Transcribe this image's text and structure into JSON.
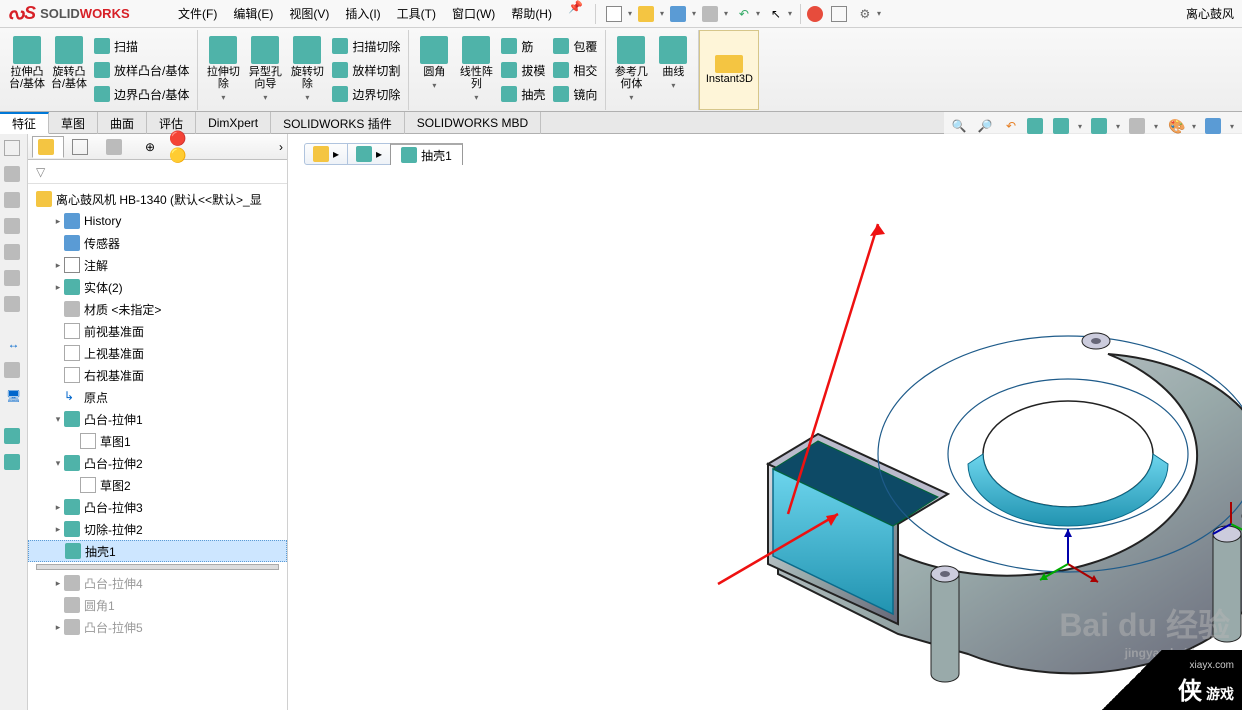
{
  "app": {
    "brand_solid": "SOLID",
    "brand_works": "WORKS",
    "doc_title": "离心鼓风"
  },
  "menu": {
    "file": "文件(F)",
    "edit": "编辑(E)",
    "view": "视图(V)",
    "insert": "插入(I)",
    "tools": "工具(T)",
    "window": "窗口(W)",
    "help": "帮助(H)"
  },
  "ribbon": {
    "extrude_boss": "拉伸凸\n台/基体",
    "revolve_boss": "旋转凸\n台/基体",
    "sweep": "扫描",
    "loft": "放样凸台/基体",
    "boundary": "边界凸台/基体",
    "extrude_cut": "拉伸切\n除",
    "hole_wizard": "异型孔\n向导",
    "revolve_cut": "旋转切\n除",
    "sweep_cut": "扫描切除",
    "loft_cut": "放样切割",
    "boundary_cut": "边界切除",
    "fillet": "圆角",
    "linear_pattern": "线性阵\n列",
    "rib": "筋",
    "draft": "拔模",
    "shell": "抽壳",
    "wrap": "包覆",
    "intersect": "相交",
    "mirror": "镜向",
    "ref_geom": "参考几\n何体",
    "curves": "曲线",
    "instant3d": "Instant3D"
  },
  "tabs": {
    "features": "特征",
    "sketch": "草图",
    "surfaces": "曲面",
    "evaluate": "评估",
    "dimxpert": "DimXpert",
    "plugins": "SOLIDWORKS 插件",
    "mbd": "SOLIDWORKS MBD"
  },
  "breadcrumb": {
    "feature": "抽壳1"
  },
  "tree": {
    "root": "离心鼓风机 HB-1340  (默认<<默认>_显",
    "history": "History",
    "sensors": "传感器",
    "annotations": "注解",
    "solid_bodies": "实体(2)",
    "material": "材质 <未指定>",
    "front_plane": "前视基准面",
    "top_plane": "上视基准面",
    "right_plane": "右视基准面",
    "origin": "原点",
    "boss_extrude1": "凸台-拉伸1",
    "sketch1": "草图1",
    "boss_extrude2": "凸台-拉伸2",
    "sketch2": "草图2",
    "boss_extrude3": "凸台-拉伸3",
    "cut_extrude2": "切除-拉伸2",
    "shell1": "抽壳1",
    "boss_extrude4": "凸台-拉伸4",
    "fillet1": "圆角1",
    "boss_extrude5": "凸台-拉伸5"
  },
  "watermark": {
    "brand": "Bai du 经验",
    "url": "jingyan.baidu.com"
  },
  "corner": {
    "url": "xiayx.com",
    "xia": "侠",
    "game": "游戏"
  }
}
